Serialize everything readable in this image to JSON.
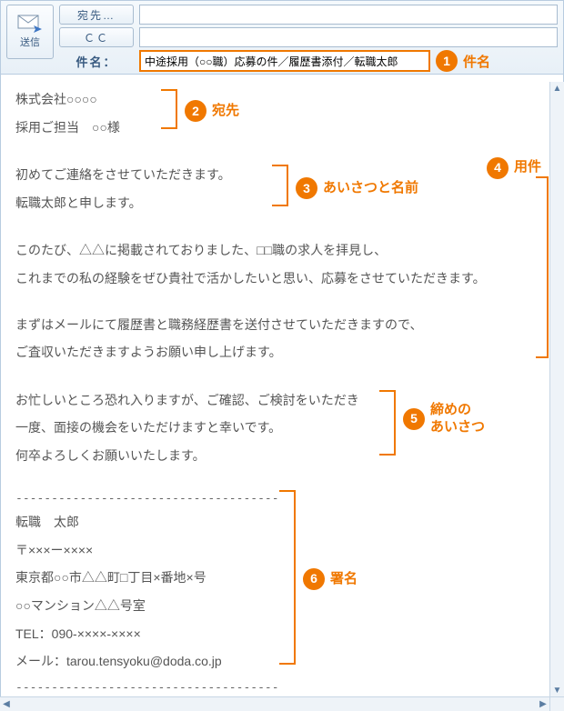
{
  "header": {
    "send_label": "送信",
    "to_button": "宛先…",
    "cc_button": "ＣＣ",
    "subject_label": "件名：",
    "to_value": "",
    "cc_value": "",
    "subject_value": "中途採用（○○職）応募の件／履歴書添付／転職太郎"
  },
  "body": {
    "recipient": {
      "line1": "株式会社○○○○",
      "line2": "採用ご担当　○○様"
    },
    "greeting": {
      "line1": "初めてご連絡をさせていただきます。",
      "line2": "転職太郎と申します。"
    },
    "purpose": {
      "line1": "このたび、△△に掲載されておりました、□□職の求人を拝見し、",
      "line2": "これまでの私の経験をぜひ貴社で活かしたいと思い、応募をさせていただきます。",
      "line3": "まずはメールにて履歴書と職務経歴書を送付させていただきますので、",
      "line4": "ご査収いただきますようお願い申し上げます。"
    },
    "closing": {
      "line1": "お忙しいところ恐れ入りますが、ご確認、ご検討をいただき",
      "line2": "一度、面接の機会をいただけますと幸いです。",
      "line3": "何卒よろしくお願いいたします。"
    },
    "signature": {
      "dash": "-------------------------------------",
      "name": "転職　太郎",
      "postal": "〒×××ー××××",
      "addr1": "東京都○○市△△町□丁目×番地×号",
      "addr2": "○○マンション△△号室",
      "tel": "TEL：090-××××-××××",
      "mail": "メール：tarou.tensyoku@doda.co.jp"
    }
  },
  "annotations": {
    "a1": "件名",
    "a2": "宛先",
    "a3": "あいさつと名前",
    "a4": "用件",
    "a5_l1": "締めの",
    "a5_l2": "あいさつ",
    "a6": "署名"
  }
}
